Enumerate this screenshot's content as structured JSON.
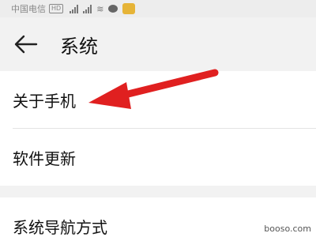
{
  "status_bar": {
    "carrier": "中国电信",
    "hd_badge": "HD"
  },
  "header": {
    "title": "系统",
    "back_icon": "arrow-left-icon"
  },
  "settings": {
    "items": [
      {
        "label": "关于手机"
      },
      {
        "label": "软件更新"
      },
      {
        "label": "系统导航方式"
      }
    ]
  },
  "annotation": {
    "arrow_color": "#e02020",
    "target": "关于手机"
  },
  "watermark": "booso.com",
  "colors": {
    "background": "#f2f2f2",
    "card": "#ffffff",
    "text": "#111111",
    "arrow": "#e02020"
  }
}
